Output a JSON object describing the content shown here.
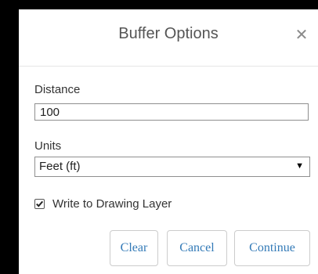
{
  "dialog": {
    "title": "Buffer Options",
    "close_icon": "close-icon",
    "close_glyph": "✕"
  },
  "distance": {
    "label": "Distance",
    "value": "100"
  },
  "units": {
    "label": "Units",
    "selected": "Feet (ft)",
    "arrow_glyph": "▼"
  },
  "write_layer": {
    "label": "Write to Drawing Layer",
    "checked": true
  },
  "buttons": {
    "clear": "Clear",
    "cancel": "Cancel",
    "continue": "Continue"
  },
  "colors": {
    "frame": "#000000",
    "button_text": "#337ab7",
    "title_text": "#555555"
  }
}
